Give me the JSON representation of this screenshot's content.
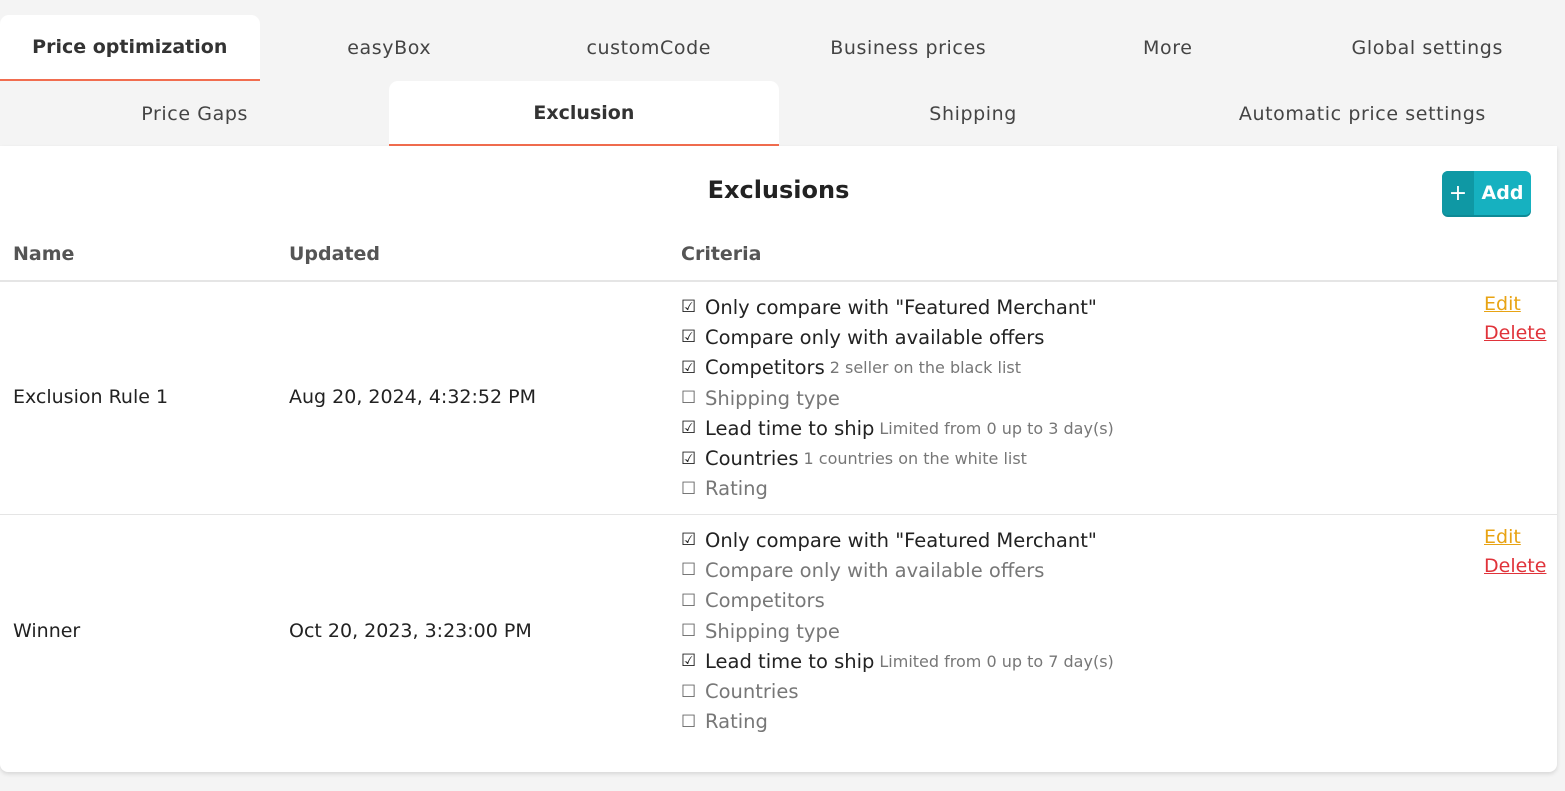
{
  "top_tabs": [
    {
      "label": "Price optimization",
      "active": true
    },
    {
      "label": "easyBox",
      "active": false
    },
    {
      "label": "customCode",
      "active": false
    },
    {
      "label": "Business prices",
      "active": false
    },
    {
      "label": "More",
      "active": false
    },
    {
      "label": "Global settings",
      "active": false
    }
  ],
  "sub_tabs": [
    {
      "label": "Price Gaps",
      "active": false
    },
    {
      "label": "Exclusion",
      "active": true
    },
    {
      "label": "Shipping",
      "active": false
    },
    {
      "label": "Automatic price settings",
      "active": false
    }
  ],
  "panel": {
    "title": "Exclusions",
    "add_icon": "+",
    "add_label": "Add"
  },
  "table": {
    "headers": {
      "name": "Name",
      "updated": "Updated",
      "criteria": "Criteria"
    },
    "rows": [
      {
        "name": "Exclusion Rule 1",
        "updated": "Aug 20, 2024, 4:32:52 PM",
        "criteria": [
          {
            "label": "Only compare with \"Featured Merchant\"",
            "checked": true,
            "note": ""
          },
          {
            "label": "Compare only with available offers",
            "checked": true,
            "note": ""
          },
          {
            "label": "Competitors",
            "checked": true,
            "note": "2 seller on the black list"
          },
          {
            "label": "Shipping type",
            "checked": false,
            "note": ""
          },
          {
            "label": "Lead time to ship",
            "checked": true,
            "note": "Limited from 0 up to 3 day(s)"
          },
          {
            "label": "Countries",
            "checked": true,
            "note": "1 countries on the white list"
          },
          {
            "label": "Rating",
            "checked": false,
            "note": ""
          }
        ],
        "edit_label": "Edit",
        "delete_label": "Delete"
      },
      {
        "name": "Winner",
        "updated": "Oct 20, 2023, 3:23:00 PM",
        "criteria": [
          {
            "label": "Only compare with \"Featured Merchant\"",
            "checked": true,
            "note": ""
          },
          {
            "label": "Compare only with available offers",
            "checked": false,
            "note": ""
          },
          {
            "label": "Competitors",
            "checked": false,
            "note": ""
          },
          {
            "label": "Shipping type",
            "checked": false,
            "note": ""
          },
          {
            "label": "Lead time to ship",
            "checked": true,
            "note": "Limited from 0 up to 7 day(s)"
          },
          {
            "label": "Countries",
            "checked": false,
            "note": ""
          },
          {
            "label": "Rating",
            "checked": false,
            "note": ""
          }
        ],
        "edit_label": "Edit",
        "delete_label": "Delete"
      }
    ]
  },
  "symbols": {
    "checked": "☑",
    "unchecked": "☐"
  },
  "colors": {
    "accent": "#f16d4f",
    "add_button": "#16b1c0",
    "edit_link": "#e8a313",
    "delete_link": "#e0333a"
  }
}
